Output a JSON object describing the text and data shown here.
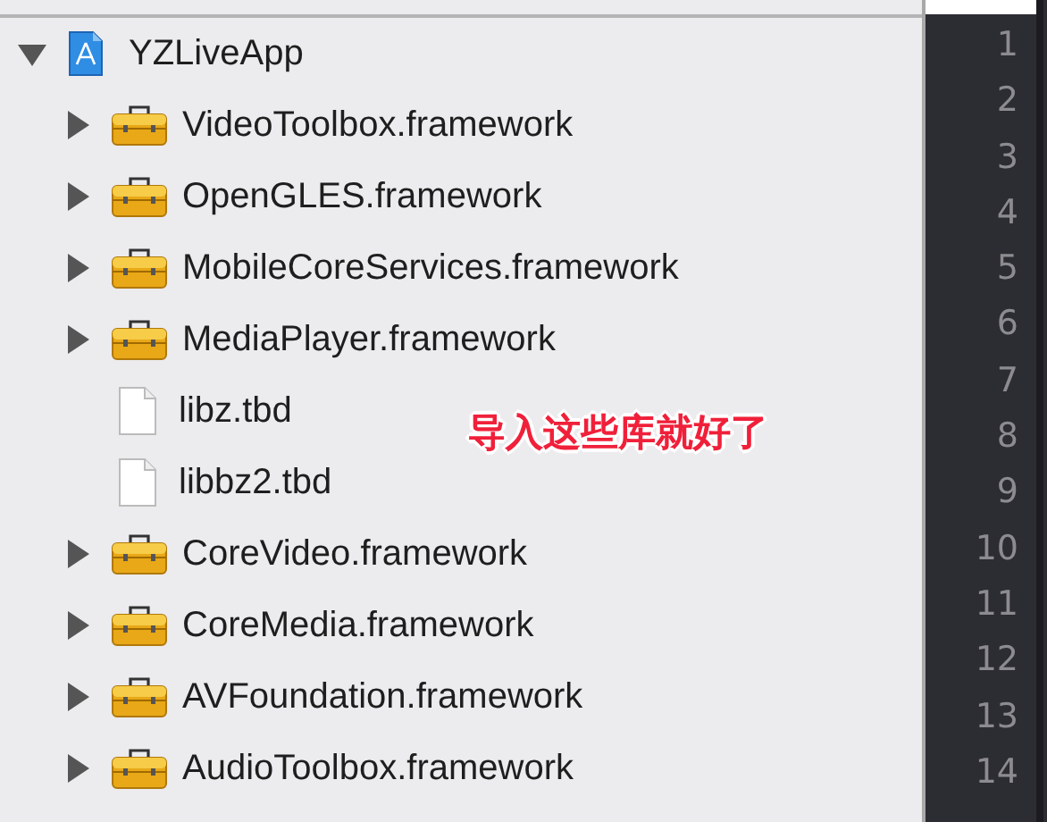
{
  "navigator": {
    "tree": [
      {
        "label": "YZLiveApp",
        "kind": "project",
        "expanded": true,
        "children": [
          {
            "label": "VideoToolbox.framework",
            "kind": "framework",
            "expanded": false
          },
          {
            "label": "OpenGLES.framework",
            "kind": "framework",
            "expanded": false
          },
          {
            "label": "MobileCoreServices.framework",
            "kind": "framework",
            "expanded": false
          },
          {
            "label": "MediaPlayer.framework",
            "kind": "framework",
            "expanded": false
          },
          {
            "label": "libz.tbd",
            "kind": "file"
          },
          {
            "label": "libbz2.tbd",
            "kind": "file"
          },
          {
            "label": "CoreVideo.framework",
            "kind": "framework",
            "expanded": false
          },
          {
            "label": "CoreMedia.framework",
            "kind": "framework",
            "expanded": false
          },
          {
            "label": "AVFoundation.framework",
            "kind": "framework",
            "expanded": false
          },
          {
            "label": "AudioToolbox.framework",
            "kind": "framework",
            "expanded": false
          }
        ]
      }
    ]
  },
  "annotation": "导入这些库就好了",
  "editor": {
    "line_numbers": [
      "1",
      "2",
      "3",
      "4",
      "5",
      "6",
      "7",
      "8",
      "9",
      "10",
      "11",
      "12",
      "13",
      "14"
    ]
  }
}
